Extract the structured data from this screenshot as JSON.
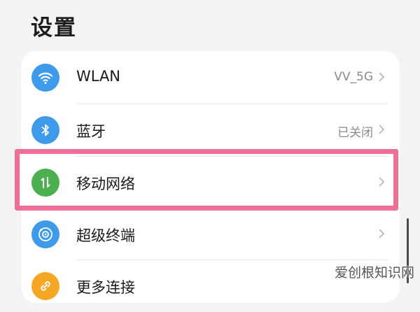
{
  "header": {
    "title": "设置"
  },
  "colors": {
    "wifi_icon_bg": "#3f9bea",
    "bluetooth_icon_bg": "#3f9bea",
    "mobile_icon_bg": "#4caf50",
    "super_device_icon_bg": "#3f9bea",
    "more_icon_bg": "#f5a623",
    "highlight_border": "#ef6f96"
  },
  "settings": {
    "items": [
      {
        "label": "WLAN",
        "value": "VV_5G",
        "icon": "wifi-icon"
      },
      {
        "label": "蓝牙",
        "value": "已关闭",
        "icon": "bluetooth-icon"
      },
      {
        "label": "移动网络",
        "value": "",
        "icon": "mobile-data-icon"
      },
      {
        "label": "超级终端",
        "value": "",
        "icon": "super-device-icon"
      },
      {
        "label": "更多连接",
        "value": "",
        "icon": "link-icon"
      }
    ]
  },
  "watermark": {
    "text": "爱创根知识网"
  }
}
